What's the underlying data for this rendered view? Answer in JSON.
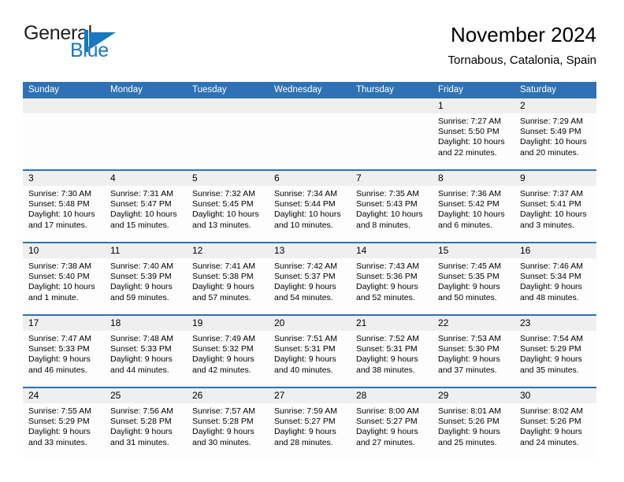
{
  "brand": {
    "name_part1": "General",
    "name_part2": "Blue",
    "accent_color": "#1878be"
  },
  "header": {
    "title": "November 2024",
    "subtitle": "Tornabous, Catalonia, Spain"
  },
  "theme": {
    "header_blue": "#2e72b5",
    "day_strip_gray": "#efefef",
    "cell_background": "#fdfdfd"
  },
  "weekdays": [
    "Sunday",
    "Monday",
    "Tuesday",
    "Wednesday",
    "Thursday",
    "Friday",
    "Saturday"
  ],
  "labels": {
    "sunrise_prefix": "Sunrise:",
    "sunset_prefix": "Sunset:",
    "daylight_prefix": "Daylight:"
  },
  "weeks": [
    [
      {
        "day": "",
        "sunrise": "",
        "sunset": "",
        "daylight": ""
      },
      {
        "day": "",
        "sunrise": "",
        "sunset": "",
        "daylight": ""
      },
      {
        "day": "",
        "sunrise": "",
        "sunset": "",
        "daylight": ""
      },
      {
        "day": "",
        "sunrise": "",
        "sunset": "",
        "daylight": ""
      },
      {
        "day": "",
        "sunrise": "",
        "sunset": "",
        "daylight": ""
      },
      {
        "day": "1",
        "sunrise": "Sunrise: 7:27 AM",
        "sunset": "Sunset: 5:50 PM",
        "daylight": "Daylight: 10 hours and 22 minutes."
      },
      {
        "day": "2",
        "sunrise": "Sunrise: 7:29 AM",
        "sunset": "Sunset: 5:49 PM",
        "daylight": "Daylight: 10 hours and 20 minutes."
      }
    ],
    [
      {
        "day": "3",
        "sunrise": "Sunrise: 7:30 AM",
        "sunset": "Sunset: 5:48 PM",
        "daylight": "Daylight: 10 hours and 17 minutes."
      },
      {
        "day": "4",
        "sunrise": "Sunrise: 7:31 AM",
        "sunset": "Sunset: 5:47 PM",
        "daylight": "Daylight: 10 hours and 15 minutes."
      },
      {
        "day": "5",
        "sunrise": "Sunrise: 7:32 AM",
        "sunset": "Sunset: 5:45 PM",
        "daylight": "Daylight: 10 hours and 13 minutes."
      },
      {
        "day": "6",
        "sunrise": "Sunrise: 7:34 AM",
        "sunset": "Sunset: 5:44 PM",
        "daylight": "Daylight: 10 hours and 10 minutes."
      },
      {
        "day": "7",
        "sunrise": "Sunrise: 7:35 AM",
        "sunset": "Sunset: 5:43 PM",
        "daylight": "Daylight: 10 hours and 8 minutes."
      },
      {
        "day": "8",
        "sunrise": "Sunrise: 7:36 AM",
        "sunset": "Sunset: 5:42 PM",
        "daylight": "Daylight: 10 hours and 6 minutes."
      },
      {
        "day": "9",
        "sunrise": "Sunrise: 7:37 AM",
        "sunset": "Sunset: 5:41 PM",
        "daylight": "Daylight: 10 hours and 3 minutes."
      }
    ],
    [
      {
        "day": "10",
        "sunrise": "Sunrise: 7:38 AM",
        "sunset": "Sunset: 5:40 PM",
        "daylight": "Daylight: 10 hours and 1 minute."
      },
      {
        "day": "11",
        "sunrise": "Sunrise: 7:40 AM",
        "sunset": "Sunset: 5:39 PM",
        "daylight": "Daylight: 9 hours and 59 minutes."
      },
      {
        "day": "12",
        "sunrise": "Sunrise: 7:41 AM",
        "sunset": "Sunset: 5:38 PM",
        "daylight": "Daylight: 9 hours and 57 minutes."
      },
      {
        "day": "13",
        "sunrise": "Sunrise: 7:42 AM",
        "sunset": "Sunset: 5:37 PM",
        "daylight": "Daylight: 9 hours and 54 minutes."
      },
      {
        "day": "14",
        "sunrise": "Sunrise: 7:43 AM",
        "sunset": "Sunset: 5:36 PM",
        "daylight": "Daylight: 9 hours and 52 minutes."
      },
      {
        "day": "15",
        "sunrise": "Sunrise: 7:45 AM",
        "sunset": "Sunset: 5:35 PM",
        "daylight": "Daylight: 9 hours and 50 minutes."
      },
      {
        "day": "16",
        "sunrise": "Sunrise: 7:46 AM",
        "sunset": "Sunset: 5:34 PM",
        "daylight": "Daylight: 9 hours and 48 minutes."
      }
    ],
    [
      {
        "day": "17",
        "sunrise": "Sunrise: 7:47 AM",
        "sunset": "Sunset: 5:33 PM",
        "daylight": "Daylight: 9 hours and 46 minutes."
      },
      {
        "day": "18",
        "sunrise": "Sunrise: 7:48 AM",
        "sunset": "Sunset: 5:33 PM",
        "daylight": "Daylight: 9 hours and 44 minutes."
      },
      {
        "day": "19",
        "sunrise": "Sunrise: 7:49 AM",
        "sunset": "Sunset: 5:32 PM",
        "daylight": "Daylight: 9 hours and 42 minutes."
      },
      {
        "day": "20",
        "sunrise": "Sunrise: 7:51 AM",
        "sunset": "Sunset: 5:31 PM",
        "daylight": "Daylight: 9 hours and 40 minutes."
      },
      {
        "day": "21",
        "sunrise": "Sunrise: 7:52 AM",
        "sunset": "Sunset: 5:31 PM",
        "daylight": "Daylight: 9 hours and 38 minutes."
      },
      {
        "day": "22",
        "sunrise": "Sunrise: 7:53 AM",
        "sunset": "Sunset: 5:30 PM",
        "daylight": "Daylight: 9 hours and 37 minutes."
      },
      {
        "day": "23",
        "sunrise": "Sunrise: 7:54 AM",
        "sunset": "Sunset: 5:29 PM",
        "daylight": "Daylight: 9 hours and 35 minutes."
      }
    ],
    [
      {
        "day": "24",
        "sunrise": "Sunrise: 7:55 AM",
        "sunset": "Sunset: 5:29 PM",
        "daylight": "Daylight: 9 hours and 33 minutes."
      },
      {
        "day": "25",
        "sunrise": "Sunrise: 7:56 AM",
        "sunset": "Sunset: 5:28 PM",
        "daylight": "Daylight: 9 hours and 31 minutes."
      },
      {
        "day": "26",
        "sunrise": "Sunrise: 7:57 AM",
        "sunset": "Sunset: 5:28 PM",
        "daylight": "Daylight: 9 hours and 30 minutes."
      },
      {
        "day": "27",
        "sunrise": "Sunrise: 7:59 AM",
        "sunset": "Sunset: 5:27 PM",
        "daylight": "Daylight: 9 hours and 28 minutes."
      },
      {
        "day": "28",
        "sunrise": "Sunrise: 8:00 AM",
        "sunset": "Sunset: 5:27 PM",
        "daylight": "Daylight: 9 hours and 27 minutes."
      },
      {
        "day": "29",
        "sunrise": "Sunrise: 8:01 AM",
        "sunset": "Sunset: 5:26 PM",
        "daylight": "Daylight: 9 hours and 25 minutes."
      },
      {
        "day": "30",
        "sunrise": "Sunrise: 8:02 AM",
        "sunset": "Sunset: 5:26 PM",
        "daylight": "Daylight: 9 hours and 24 minutes."
      }
    ]
  ]
}
